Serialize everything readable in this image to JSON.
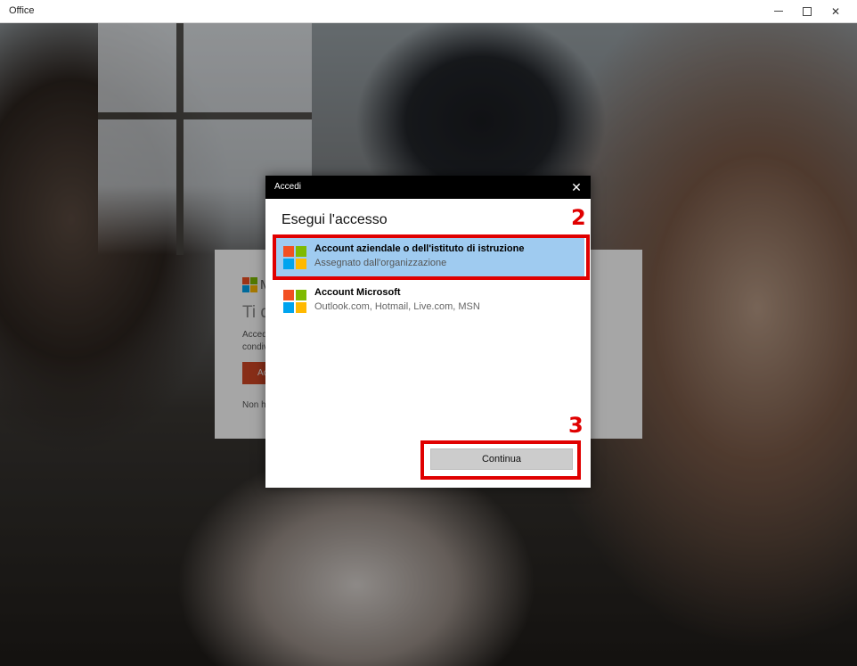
{
  "app": {
    "title": "Office",
    "controls": {
      "minimize": "minimize-icon",
      "maximize": "maximize-icon",
      "close": "✕"
    }
  },
  "background_card": {
    "brand_partial": "M",
    "heading_partial": "Ti d",
    "desc_line1": "Acced",
    "desc_line2": "condiv",
    "button_partial": "Ac",
    "footer_partial": "Non h"
  },
  "modal": {
    "title": "Accedi",
    "close_label": "✕",
    "heading": "Esegui l'accesso",
    "accounts": [
      {
        "name": "Account aziendale o dell'istituto di istruzione",
        "subtitle": "Assegnato dall'organizzazione",
        "selected": true
      },
      {
        "name": "Account Microsoft",
        "subtitle": "Outlook.com, Hotmail, Live.com, MSN",
        "selected": false
      }
    ],
    "continue_label": "Continua"
  },
  "annotations": {
    "step2": "2",
    "step3": "3",
    "color": "#e00000"
  },
  "colors": {
    "ms_red": "#f25022",
    "ms_green": "#7fba00",
    "ms_blue": "#00a4ef",
    "ms_yellow": "#ffb900",
    "selected_bg": "#9fcbf0",
    "office_orange": "#d24726"
  }
}
